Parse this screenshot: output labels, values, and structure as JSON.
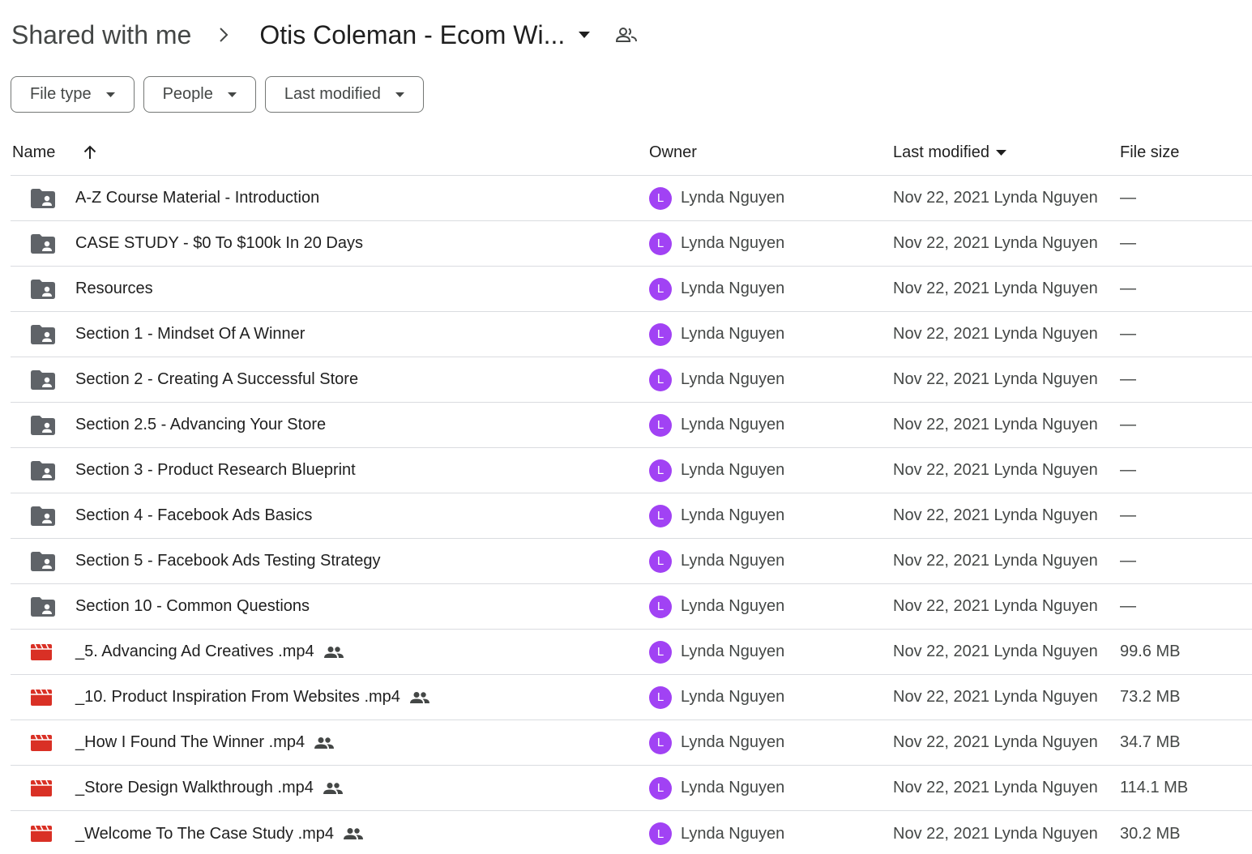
{
  "breadcrumb": {
    "root": "Shared with me",
    "current": "Otis Coleman - Ecom Wi..."
  },
  "icons": {
    "separator": "chevron-right-icon",
    "dropdown": "arrow-drop-down-icon",
    "shared": "people-outline-icon",
    "folder": "shared-folder-icon",
    "video": "video-file-icon",
    "sort": "arrow-upward-icon"
  },
  "colors": {
    "avatar": "#a142f4",
    "video_icon": "#d93025",
    "folder_icon": "#5f6368"
  },
  "filters": [
    {
      "label": "File type"
    },
    {
      "label": "People"
    },
    {
      "label": "Last modified"
    }
  ],
  "table": {
    "headers": {
      "name": "Name",
      "owner": "Owner",
      "modified": "Last modified",
      "size": "File size"
    },
    "rows": [
      {
        "type": "folder",
        "name": "A-Z Course Material - Introduction",
        "shared": false,
        "owner_initial": "L",
        "owner": "Lynda Nguyen",
        "modified": "Nov 22, 2021 Lynda Nguyen",
        "size": "—"
      },
      {
        "type": "folder",
        "name": "CASE STUDY - $0 To $100k In 20 Days",
        "shared": false,
        "owner_initial": "L",
        "owner": "Lynda Nguyen",
        "modified": "Nov 22, 2021 Lynda Nguyen",
        "size": "—"
      },
      {
        "type": "folder",
        "name": "Resources",
        "shared": false,
        "owner_initial": "L",
        "owner": "Lynda Nguyen",
        "modified": "Nov 22, 2021 Lynda Nguyen",
        "size": "—"
      },
      {
        "type": "folder",
        "name": "Section 1 - Mindset Of A Winner",
        "shared": false,
        "owner_initial": "L",
        "owner": "Lynda Nguyen",
        "modified": "Nov 22, 2021 Lynda Nguyen",
        "size": "—"
      },
      {
        "type": "folder",
        "name": "Section 2 - Creating A Successful Store",
        "shared": false,
        "owner_initial": "L",
        "owner": "Lynda Nguyen",
        "modified": "Nov 22, 2021 Lynda Nguyen",
        "size": "—"
      },
      {
        "type": "folder",
        "name": "Section 2.5 - Advancing Your Store",
        "shared": false,
        "owner_initial": "L",
        "owner": "Lynda Nguyen",
        "modified": "Nov 22, 2021 Lynda Nguyen",
        "size": "—"
      },
      {
        "type": "folder",
        "name": "Section 3 - Product Research Blueprint",
        "shared": false,
        "owner_initial": "L",
        "owner": "Lynda Nguyen",
        "modified": "Nov 22, 2021 Lynda Nguyen",
        "size": "—"
      },
      {
        "type": "folder",
        "name": "Section 4 - Facebook Ads Basics",
        "shared": false,
        "owner_initial": "L",
        "owner": "Lynda Nguyen",
        "modified": "Nov 22, 2021 Lynda Nguyen",
        "size": "—"
      },
      {
        "type": "folder",
        "name": "Section 5 - Facebook Ads Testing Strategy",
        "shared": false,
        "owner_initial": "L",
        "owner": "Lynda Nguyen",
        "modified": "Nov 22, 2021 Lynda Nguyen",
        "size": "—"
      },
      {
        "type": "folder",
        "name": "Section 10 - Common Questions",
        "shared": false,
        "owner_initial": "L",
        "owner": "Lynda Nguyen",
        "modified": "Nov 22, 2021 Lynda Nguyen",
        "size": "—"
      },
      {
        "type": "video",
        "name": "_5. Advancing Ad Creatives .mp4",
        "shared": true,
        "owner_initial": "L",
        "owner": "Lynda Nguyen",
        "modified": "Nov 22, 2021 Lynda Nguyen",
        "size": "99.6 MB"
      },
      {
        "type": "video",
        "name": "_10. Product Inspiration From Websites .mp4",
        "shared": true,
        "owner_initial": "L",
        "owner": "Lynda Nguyen",
        "modified": "Nov 22, 2021 Lynda Nguyen",
        "size": "73.2 MB"
      },
      {
        "type": "video",
        "name": "_How I Found The Winner .mp4",
        "shared": true,
        "owner_initial": "L",
        "owner": "Lynda Nguyen",
        "modified": "Nov 22, 2021 Lynda Nguyen",
        "size": "34.7 MB"
      },
      {
        "type": "video",
        "name": "_Store Design Walkthrough .mp4",
        "shared": true,
        "owner_initial": "L",
        "owner": "Lynda Nguyen",
        "modified": "Nov 22, 2021 Lynda Nguyen",
        "size": "114.1 MB"
      },
      {
        "type": "video",
        "name": "_Welcome To The Case Study  .mp4",
        "shared": true,
        "owner_initial": "L",
        "owner": "Lynda Nguyen",
        "modified": "Nov 22, 2021 Lynda Nguyen",
        "size": "30.2 MB"
      }
    ]
  }
}
